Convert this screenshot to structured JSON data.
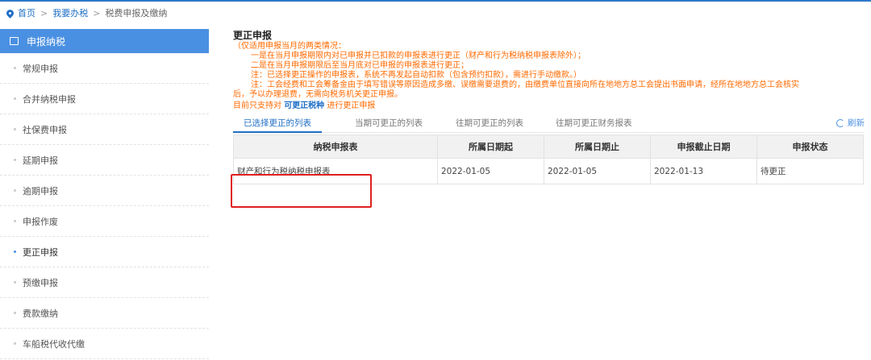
{
  "breadcrumb": {
    "home": "首页",
    "sep": ">",
    "level2": "我要办税",
    "current": "税费申报及缴纳"
  },
  "sidebar": {
    "header": "申报纳税",
    "items": [
      {
        "label": "常规申报"
      },
      {
        "label": "合并纳税申报"
      },
      {
        "label": "社保费申报"
      },
      {
        "label": "延期申报"
      },
      {
        "label": "逾期申报"
      },
      {
        "label": "申报作废"
      },
      {
        "label": "更正申报",
        "active": true
      },
      {
        "label": "预缴申报"
      },
      {
        "label": "费款缴纳"
      },
      {
        "label": "车船税代收代缴"
      }
    ]
  },
  "main": {
    "title": "更正申报",
    "notes": [
      "（仅适用申报当月的两类情况：",
      "一是在当月申报期限内对已申报并已扣款的申报表进行更正（财产和行为税纳税申报表除外）；",
      "二是在当月申报期限后至当月底对已申报的申报表进行更正；",
      "注：已选择更正操作的申报表，系统不再发起自动扣款（包含预约扣款），需进行手动缴款。）",
      "注：工会经费和工会筹备金由于填写错误等原因造成多缴、误缴需要退费的，由缴费单位直接向所在地地方总工会提出书面申请，经所在地地方总工会核实",
      "后，予以办理退费，无需向税务机关更正申报。"
    ],
    "support_prefix": "目前只支持对",
    "support_link": "可更正税种",
    "support_suffix": "进行更正申报",
    "tabs": [
      "已选择更正的列表",
      "当期可更正的列表",
      "往期可更正的列表",
      "往期可更正财务报表"
    ],
    "refresh_label": "刷新",
    "table": {
      "headers": [
        "纳税申报表",
        "所属日期起",
        "所属日期止",
        "申报截止日期",
        "申报状态"
      ],
      "rows": [
        [
          "财产和行为税纳税申报表",
          "2022-01-05",
          "2022-01-05",
          "2022-01-13",
          "待更正"
        ]
      ]
    }
  },
  "colors": {
    "accent": "#4a90e2",
    "link": "#1f6fc5",
    "warning": "#ff6a00",
    "highlight_box": "#e02020"
  }
}
